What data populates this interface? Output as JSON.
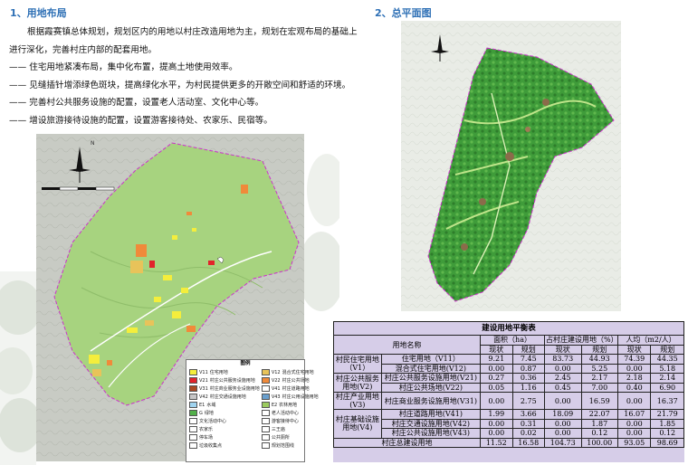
{
  "section1": {
    "title": "1、用地布局",
    "paragraph": "根据霞赛镇总体规划，规划区内的用地以村庄改造用地为主，规划在宏观布局的基础上进行深化，完善村庄内部的配套用地。",
    "bullets": [
      "—— 住宅用地紧凑布局，集中化布置，提高土地使用效率。",
      "—— 见缝插针增添绿色斑块，提高绿化水平，为村民提供更多的开敞空间和舒适的环境。",
      "—— 完善村公共服务设施的配置，设置老人活动室、文化中心等。",
      "—— 增设旅游接待设施的配置，设置游客接待处、农家乐、民宿等。"
    ]
  },
  "section2": {
    "title": "2、总平面图"
  },
  "legend": {
    "title": "图例",
    "items": [
      {
        "code": "V11",
        "label": "住宅用地",
        "color": "#f4ee3c"
      },
      {
        "code": "V12",
        "label": "混合式住宅用地",
        "color": "#e8c35a"
      },
      {
        "code": "V21",
        "label": "村庄公共服务设施用地",
        "color": "#e2232b"
      },
      {
        "code": "V22",
        "label": "村庄公共场地",
        "color": "#f08a3a"
      },
      {
        "code": "V31",
        "label": "村庄商业服务业设施用地",
        "color": "#a94a23"
      },
      {
        "code": "V41",
        "label": "村庄道路用地",
        "color": "#ffffff"
      },
      {
        "code": "V42",
        "label": "村庄交通设施用地",
        "color": "#c6c6c6"
      },
      {
        "code": "V43",
        "label": "村庄公用设施用地",
        "color": "#6aa0cf"
      },
      {
        "code": "E1",
        "label": "水域",
        "color": "#9fd3ef"
      },
      {
        "code": "E2",
        "label": "农林用地",
        "color": "#9ccb5e"
      },
      {
        "code": "G",
        "label": "绿地",
        "color": "#52b04a"
      },
      {
        "code": "",
        "label": "老人活动中心",
        "color": "#ffffff"
      },
      {
        "code": "",
        "label": "文化活动中心",
        "color": "#ffffff"
      },
      {
        "code": "",
        "label": "游客接待中心",
        "color": "#ffffff"
      },
      {
        "code": "",
        "label": "农家乐",
        "color": "#ffffff"
      },
      {
        "code": "",
        "label": "三王庙",
        "color": "#ffffff"
      },
      {
        "code": "",
        "label": "停车场",
        "color": "#ffffff"
      },
      {
        "code": "",
        "label": "公共厕所",
        "color": "#ffffff"
      },
      {
        "code": "",
        "label": "垃圾收集点",
        "color": "#ffffff"
      },
      {
        "code": "",
        "label": "规划范围线",
        "color": "#ffffff"
      }
    ]
  },
  "table": {
    "title": "建设用地平衡表",
    "header_name": "用地名称",
    "header_groups": [
      "面积（ha）",
      "占村庄建设用地（%）",
      "人均（m2/人）"
    ],
    "sub_headers": [
      "现状",
      "规划",
      "现状",
      "规划",
      "现状",
      "规划"
    ],
    "rows": [
      {
        "group": "村民住宅用地（V1）",
        "name": "住宅用地（V11）",
        "vals": [
          "9.21",
          "7.45",
          "83.73",
          "44.93",
          "74.39",
          "44.35"
        ]
      },
      {
        "group": "",
        "name": "混合式住宅用地(V12)",
        "vals": [
          "0.00",
          "0.87",
          "0.00",
          "5.25",
          "0.00",
          "5.18"
        ]
      },
      {
        "group": "村庄公共服务用地(V2)",
        "name": "村庄公共服务设施用地(V21)",
        "vals": [
          "0.27",
          "0.36",
          "2.45",
          "2.17",
          "2.18",
          "2.14"
        ]
      },
      {
        "group": "",
        "name": "村庄公共场地(V22)",
        "vals": [
          "0.05",
          "1.16",
          "0.45",
          "7.00",
          "0.40",
          "6.90"
        ]
      },
      {
        "group": "村庄产业用地(V3)",
        "name": "村庄商业服务设施用地(V31)",
        "vals": [
          "0.00",
          "2.75",
          "0.00",
          "16.59",
          "0.00",
          "16.37"
        ]
      },
      {
        "group": "村庄基础设施用地(V4)",
        "name": "村庄道路用地(V41)",
        "vals": [
          "1.99",
          "3.66",
          "18.09",
          "22.07",
          "16.07",
          "21.79"
        ]
      },
      {
        "group": "",
        "name": "村庄交通设施用地(V42)",
        "vals": [
          "0.00",
          "0.31",
          "0.00",
          "1.87",
          "0.00",
          "1.85"
        ]
      },
      {
        "group": "",
        "name": "村庄公共设施用地(V43)",
        "vals": [
          "0.00",
          "0.02",
          "0.00",
          "0.12",
          "0.00",
          "0.12"
        ]
      }
    ],
    "total": {
      "name": "村庄总建设用地",
      "vals": [
        "11.52",
        "16.58",
        "104.73",
        "100.00",
        "93.05",
        "98.69"
      ]
    }
  }
}
